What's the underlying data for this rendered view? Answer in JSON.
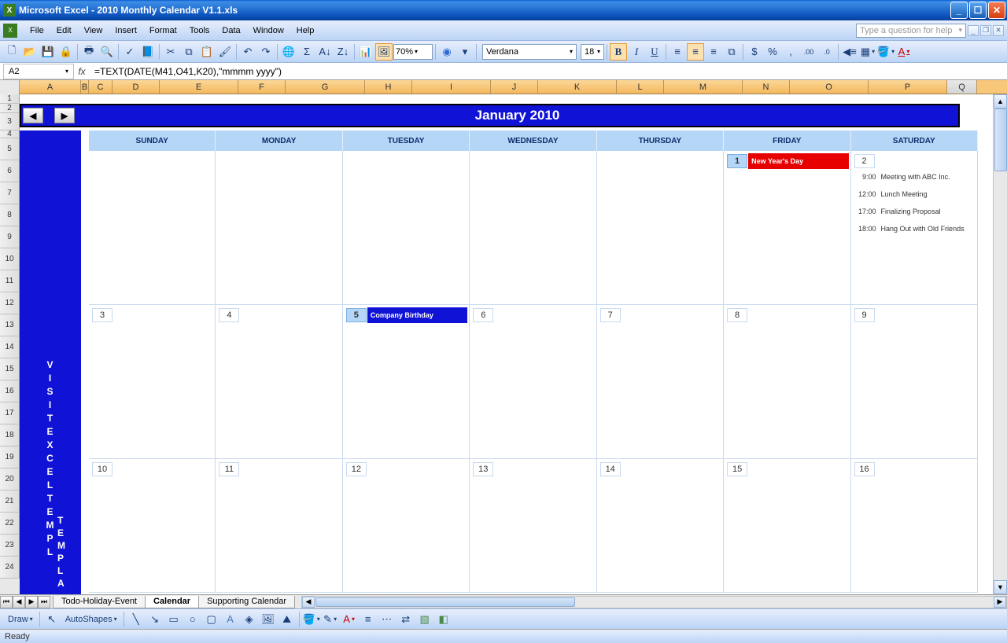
{
  "title": "Microsoft Excel - 2010 Monthly Calendar V1.1.xls",
  "menus": [
    "File",
    "Edit",
    "View",
    "Insert",
    "Format",
    "Tools",
    "Data",
    "Window",
    "Help"
  ],
  "help_placeholder": "Type a question for help",
  "zoom": "70%",
  "font_name": "Verdana",
  "font_size": "18",
  "name_box": "A2",
  "formula": "=TEXT(DATE(M41,O41,K20),\"mmmm yyyy\")",
  "columns": [
    "A",
    "B",
    "C",
    "D",
    "E",
    "F",
    "G",
    "H",
    "I",
    "J",
    "K",
    "L",
    "M",
    "N",
    "O",
    "P",
    "Q"
  ],
  "rows": [
    1,
    2,
    3,
    4,
    5,
    6,
    7,
    8,
    9,
    10,
    11,
    12,
    13,
    14,
    15,
    16,
    17,
    18,
    19,
    20,
    21,
    22,
    23,
    24
  ],
  "month_title": "January 2010",
  "side_text": [
    "V",
    "I",
    "S",
    "I",
    "T",
    "",
    "E",
    "X",
    "C",
    "E",
    "L",
    "T",
    "E",
    "M",
    "P",
    "L"
  ],
  "side_text2": [
    "T",
    "E",
    "M",
    "P",
    "L",
    "A"
  ],
  "day_names": [
    "SUNDAY",
    "MONDAY",
    "TUESDAY",
    "WEDNESDAY",
    "THURSDAY",
    "FRIDAY",
    "SATURDAY"
  ],
  "weeks": [
    {
      "days": [
        {
          "num": null
        },
        {
          "num": null
        },
        {
          "num": null
        },
        {
          "num": null
        },
        {
          "num": null
        },
        {
          "num": 1,
          "hl": true,
          "event": {
            "type": "red",
            "label": "New Year's Day"
          }
        },
        {
          "num": 2,
          "appts": [
            {
              "time": "9:00",
              "text": "Meeting with ABC Inc."
            },
            {
              "time": "12:00",
              "text": "Lunch Meeting"
            },
            {
              "time": "17:00",
              "text": "Finalizing Proposal"
            },
            {
              "time": "18:00",
              "text": "Hang Out with Old Friends"
            }
          ]
        }
      ]
    },
    {
      "days": [
        {
          "num": 3
        },
        {
          "num": 4
        },
        {
          "num": 5,
          "hl": true,
          "event": {
            "type": "blue",
            "label": "Company Birthday"
          }
        },
        {
          "num": 6
        },
        {
          "num": 7
        },
        {
          "num": 8
        },
        {
          "num": 9
        }
      ]
    },
    {
      "days": [
        {
          "num": 10
        },
        {
          "num": 11
        },
        {
          "num": 12
        },
        {
          "num": 13
        },
        {
          "num": 14
        },
        {
          "num": 15
        },
        {
          "num": 16
        }
      ]
    }
  ],
  "sheet_tabs": [
    "Todo-Holiday-Event",
    "Calendar",
    "Supporting Calendar"
  ],
  "active_tab": 1,
  "draw_label": "Draw",
  "autoshapes_label": "AutoShapes",
  "status": "Ready"
}
